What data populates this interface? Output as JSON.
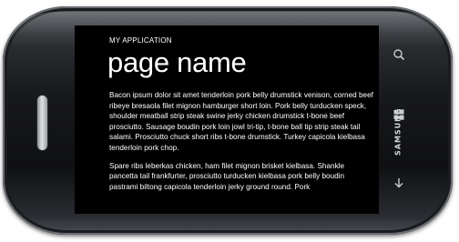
{
  "app": {
    "title": "MY APPLICATION",
    "page_title": "page name"
  },
  "content": {
    "paragraphs": [
      "Bacon ipsum dolor sit amet tenderloin pork belly drumstick venison, corned beef ribeye bresaola filet mignon hamburger short loin. Pork belly turducken speck, shoulder meatball strip steak swine jerky chicken drumstick t-bone beef prosciutto. Sausage boudin pork loin jowl tri-tip, t-bone ball tip strip steak tail salami. Prosciutto chuck short ribs t-bone drumstick. Turkey capicola kielbasa tenderloin pork chop.",
      "Spare ribs leberkas chicken, ham filet mignon brisket kielbasa. Shankle pancetta tail frankfurter, prosciutto turducken kielbasa pork belly boudin pastrami biltong capicola tenderloin jerky ground round. Pork"
    ]
  },
  "device": {
    "brand": "SAMSUNG",
    "buttons": [
      {
        "name": "search-icon"
      },
      {
        "name": "windows-start-icon"
      },
      {
        "name": "back-arrow-icon"
      }
    ]
  }
}
